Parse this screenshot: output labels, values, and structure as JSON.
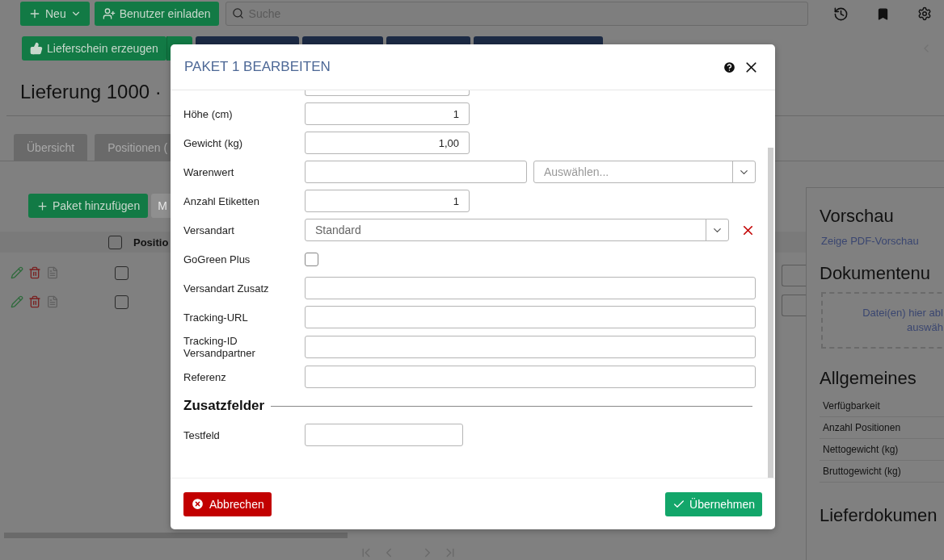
{
  "topbar": {
    "new_button": "Neu",
    "invite_button": "Benutzer einladen",
    "search": {
      "placeholder": "Suche"
    }
  },
  "actions": {
    "primary_button": "Lieferschein erzeugen"
  },
  "page_title": "Lieferung 1000 ·",
  "tabs": [
    "Übersicht",
    "Positionen ("
  ],
  "packages": {
    "add_button": "Paket hinzufügen",
    "second_button": "M",
    "header": "Positio",
    "header_checked": false,
    "rows": [
      {
        "checked": false
      },
      {
        "checked": false
      }
    ]
  },
  "side_panel": {
    "preview_title": "Vorschau",
    "preview_link": "Zeige PDF-Vorschau",
    "upload_title": "Dokumentenu",
    "dropzone": [
      "Datei(en) hier abl",
      "auswäh"
    ],
    "general_title": "Allgemeines",
    "general_rows": [
      "Verfügbarkeit",
      "Anzahl Positionen",
      "Nettogewicht (kg)",
      "Bruttogewicht (kg)"
    ],
    "docs_title": "Lieferdokumen"
  },
  "dialog": {
    "title": "PAKET 1 BEARBEITEN",
    "fields": [
      {
        "label": "Höhe (cm)",
        "kind": "number",
        "value": "1"
      },
      {
        "label": "Gewicht (kg)",
        "kind": "number",
        "value": "1,00"
      },
      {
        "label": "Warenwert",
        "kind": "amount",
        "currency_placeholder": "Auswählen..."
      },
      {
        "label": "Anzahl Etiketten",
        "kind": "number",
        "value": "1"
      },
      {
        "label": "Versandart",
        "kind": "select",
        "value": "Standard"
      },
      {
        "label": "GoGreen Plus",
        "kind": "checkbox",
        "checked": false
      },
      {
        "label": "Versandart Zusatz",
        "kind": "text"
      },
      {
        "label": "Tracking-URL",
        "kind": "text"
      },
      {
        "label": "Tracking-ID Versandpartner",
        "kind": "text"
      },
      {
        "label": "Referenz",
        "kind": "text"
      }
    ],
    "section_title": "Zusatzfelder",
    "extra_fields": [
      {
        "label": "Testfeld",
        "kind": "short"
      }
    ],
    "cancel_button": "Abbrechen",
    "apply_button": "Übernehmen"
  }
}
